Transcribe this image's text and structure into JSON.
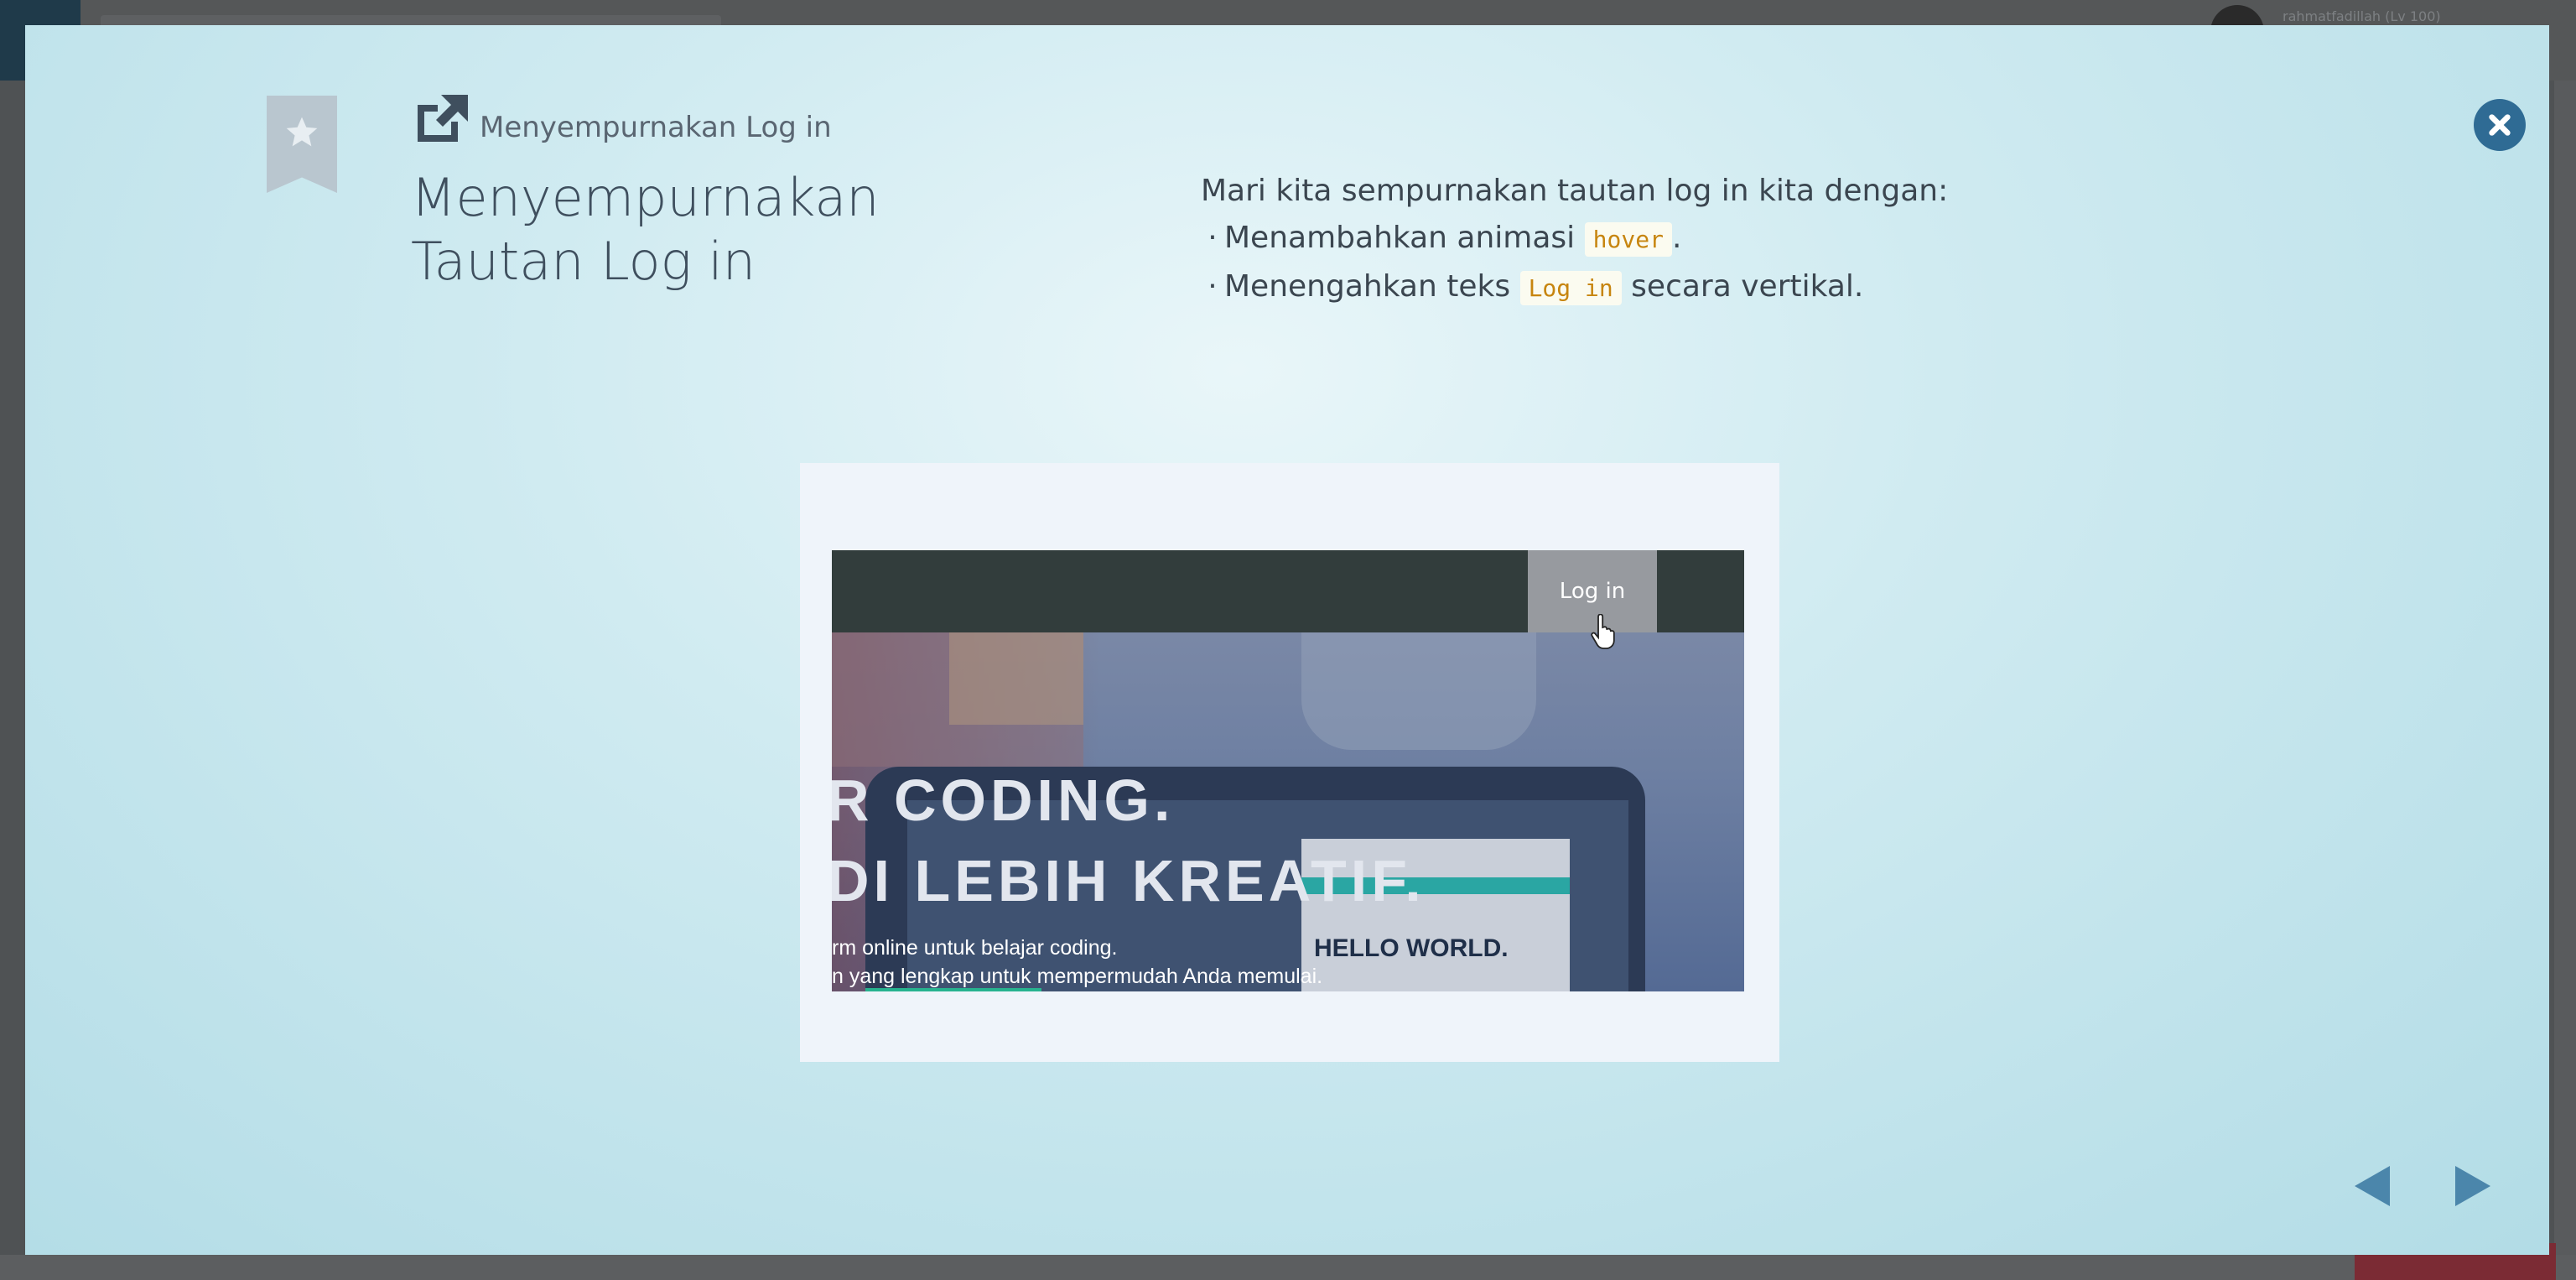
{
  "background_page": {
    "username": "rahmatfadillah (Lv 100)"
  },
  "modal": {
    "breadcrumb": "Menyempurnakan Log in",
    "title_line1": "Menyempurnakan",
    "title_line2": "Tautan Log in",
    "intro": "Mari kita sempurnakan tautan log in kita dengan:",
    "bullets": [
      {
        "before": "Menambahkan animasi ",
        "code": "hover",
        "after": "."
      },
      {
        "before": "Menengahkan teks ",
        "code": "Log in",
        "after": " secara vertikal."
      }
    ],
    "preview": {
      "login_label": "Log in",
      "hero_line1": "R CODING.",
      "hero_line2": "DI LEBIH KREATIF.",
      "hero_sub1": "rm online untuk belajar coding.",
      "hero_sub2": "n yang lengkap untuk mempermudah Anda memulai.",
      "laptop_text": "HELLO WORLD."
    }
  },
  "colors": {
    "accent": "#2f6b94",
    "code_text": "#c7850f",
    "nav_dark": "#323d3c"
  },
  "icons": {
    "bookmark": "bookmark-star-icon",
    "external": "external-link-icon",
    "close": "close-icon",
    "prev": "arrow-left-icon",
    "next": "arrow-right-icon",
    "cursor": "hand-pointer-icon"
  }
}
